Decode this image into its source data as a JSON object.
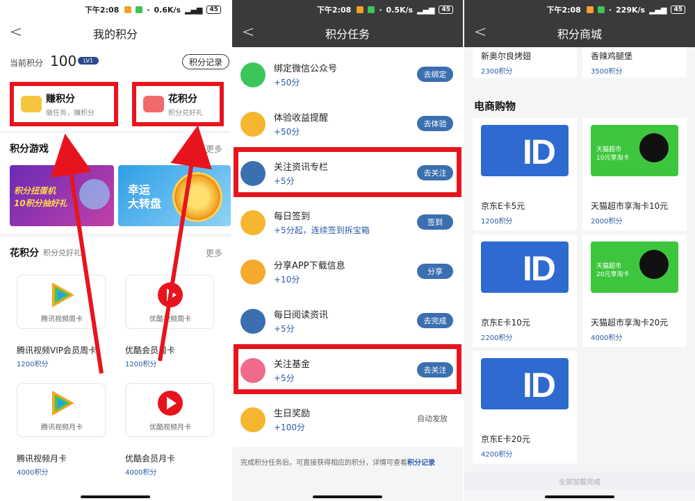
{
  "status": {
    "time": "下午2:08",
    "speed_1": "0.6K/s",
    "speed_2": "0.5K/s",
    "speed_3": "229K/s",
    "battery": "45"
  },
  "panel1": {
    "title": "我的积分",
    "current_label": "当前积分",
    "current_value": "100",
    "level": "LV1",
    "record_button": "积分记录",
    "earn": {
      "title": "赚积分",
      "subtitle": "做任务，赚积分"
    },
    "spend": {
      "title": "花积分",
      "subtitle": "积分兑好礼"
    },
    "games": {
      "title": "积分游戏",
      "more": "更多",
      "banner1_line1": "积分扭蛋机",
      "banner1_line2": "10积分抽好礼",
      "banner2_line1": "幸运",
      "banner2_line2": "大转盘"
    },
    "spend_section": {
      "title": "花积分",
      "subtitle": "积分兑好礼",
      "more": "更多",
      "products": [
        {
          "logo_text": "腾讯视频周卡",
          "name": "腾讯视频VIP会员周卡",
          "price": "1200积分"
        },
        {
          "logo_text": "优酷视频周卡",
          "name": "优酷会员周卡",
          "price": "1200积分"
        },
        {
          "logo_text": "腾讯视频月卡",
          "name": "腾讯视频月卡",
          "price": "4000积分"
        },
        {
          "logo_text": "优酷视频月卡",
          "name": "优酷会员月卡",
          "price": "4000积分"
        }
      ]
    }
  },
  "panel2": {
    "title": "积分任务",
    "tasks": [
      {
        "title": "绑定微信公众号",
        "points": "+50分",
        "button": "去绑定",
        "icon": "wechat-icon",
        "color": "#3cc65a"
      },
      {
        "title": "体验收益提醒",
        "points": "+50分",
        "button": "去体验",
        "icon": "bell-icon",
        "color": "#f5b52e"
      },
      {
        "title": "关注资讯专栏",
        "points": "+5分",
        "button": "去关注",
        "icon": "list-icon",
        "color": "#3a6fb0"
      },
      {
        "title": "每日签到",
        "points": "+5分起，连续签到拆宝箱",
        "button": "签到",
        "icon": "calendar-icon",
        "color": "#f5b52e"
      },
      {
        "title": "分享APP下载信息",
        "points": "+10分",
        "button": "分享",
        "icon": "share-icon",
        "color": "#f5a92e"
      },
      {
        "title": "每日阅读资讯",
        "points": "+5分",
        "button": "去完成",
        "icon": "book-icon",
        "color": "#3a6fb0"
      },
      {
        "title": "关注基金",
        "points": "+5分",
        "button": "去关注",
        "icon": "heart-icon",
        "color": "#f06a8a"
      },
      {
        "title": "生日奖励",
        "points": "+100分",
        "button": "自动发放",
        "icon": "cake-icon",
        "color": "#f5b52e"
      }
    ],
    "footnote_prefix": "完成积分任务后，可直接获得相应的积分，详情可查看",
    "footnote_link": "积分记录"
  },
  "panel3": {
    "title": "积分商城",
    "top_items": [
      {
        "name": "新奥尔良烤翅",
        "price": "2300积分"
      },
      {
        "name": "香辣鸡腿堡",
        "price": "3500积分"
      }
    ],
    "section_title": "电商购物",
    "items": [
      {
        "name": "京东E卡5元",
        "price": "1200积分",
        "card_text": "ID"
      },
      {
        "name": "天猫超市享淘卡10元",
        "price": "2000积分",
        "card_title": "天猫超市",
        "card_sub": "10元享淘卡"
      },
      {
        "name": "京东E卡10元",
        "price": "2200积分",
        "card_text": "ID"
      },
      {
        "name": "天猫超市享淘卡20元",
        "price": "4000积分",
        "card_title": "天猫超市",
        "card_sub": "20元享淘卡"
      },
      {
        "name": "京东E卡20元",
        "price": "4200积分",
        "card_text": "ID"
      }
    ],
    "load_done": "全部加载完成"
  }
}
